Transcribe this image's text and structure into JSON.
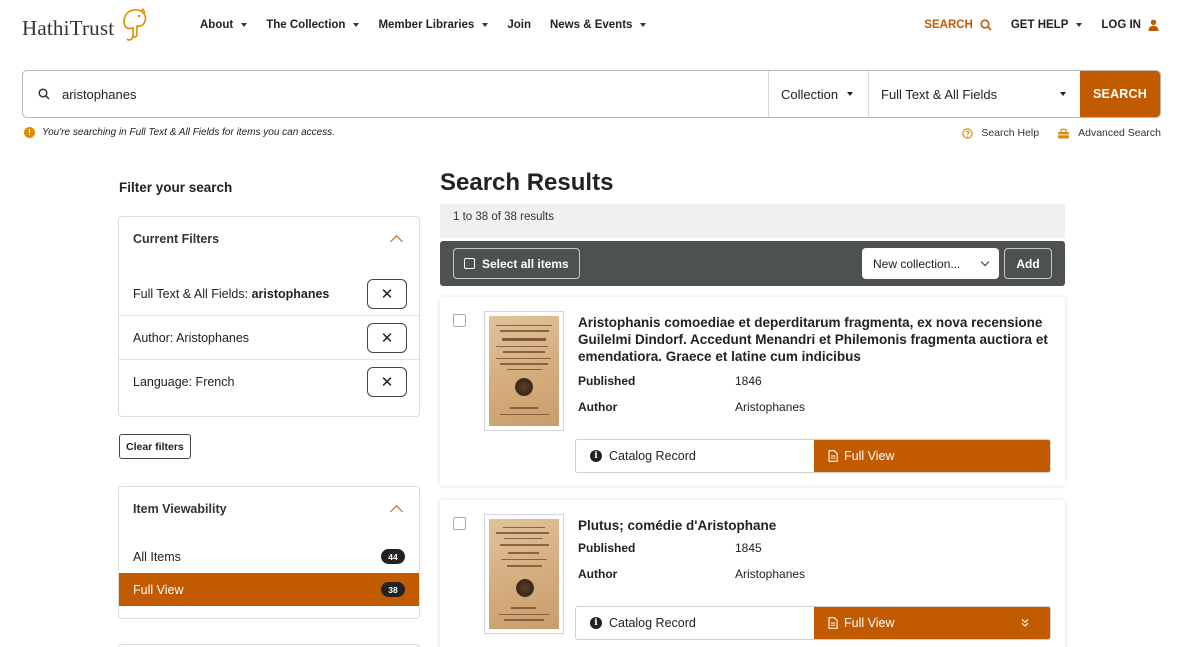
{
  "brand": {
    "name": "HathiTrust",
    "accent": "#c25a00"
  },
  "nav": [
    {
      "label": "About",
      "has_menu": true
    },
    {
      "label": "The Collection",
      "has_menu": true
    },
    {
      "label": "Member Libraries",
      "has_menu": true
    },
    {
      "label": "Join",
      "has_menu": false
    },
    {
      "label": "News & Events",
      "has_menu": true
    }
  ],
  "utility": {
    "search": "SEARCH",
    "help": "GET HELP",
    "login": "LOG IN"
  },
  "search": {
    "query": "aristophanes",
    "scope": "Collection",
    "field": "Full Text & All Fields",
    "button": "SEARCH",
    "notice": "You're searching in Full Text & All Fields for items you can access.",
    "help_link": "Search Help",
    "advanced_link": "Advanced Search"
  },
  "sidebar": {
    "title": "Filter your search",
    "current_filters": {
      "heading": "Current Filters",
      "items": [
        {
          "prefix": "Full Text & All Fields:",
          "value": "aristophanes"
        },
        {
          "prefix": "Author: Aristophanes",
          "value": ""
        },
        {
          "prefix": "Language: French",
          "value": ""
        }
      ],
      "remove_glyph": "✕"
    },
    "clear_label": "Clear filters",
    "viewability": {
      "heading": "Item Viewability",
      "options": [
        {
          "label": "All Items",
          "count": "44",
          "active": false
        },
        {
          "label": "Full View",
          "count": "38",
          "active": true
        }
      ]
    }
  },
  "results": {
    "title": "Search Results",
    "count_text": "1 to 38 of 38 results",
    "toolbar": {
      "select_all": "Select all items",
      "collection_select": "New collection...",
      "add": "Add"
    },
    "items": [
      {
        "title": "Aristophanis comoediae et deperditarum fragmenta, ex nova recensione Guilelmi Dindorf. Accedunt Menandri et Philemonis fragmenta auctiora et emendatiora. Graece et latine cum indicibus",
        "published_label": "Published",
        "published": "1846",
        "author_label": "Author",
        "author": "Aristophanes",
        "catalog": "Catalog Record",
        "full_view": "Full View"
      },
      {
        "title": "Plutus; comédie d'Aristophane",
        "published_label": "Published",
        "published": "1845",
        "author_label": "Author",
        "author": "Aristophanes",
        "catalog": "Catalog Record",
        "full_view": "Full View"
      }
    ]
  }
}
